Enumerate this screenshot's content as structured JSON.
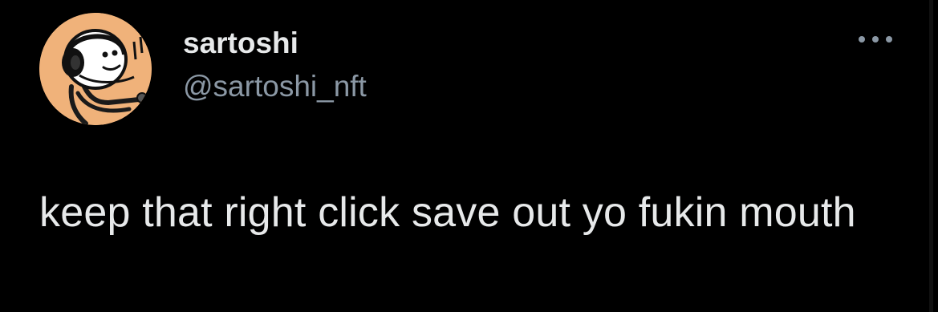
{
  "user": {
    "display_name": "sartoshi",
    "handle": "@sartoshi_nft",
    "avatar_icon": "cartoon-avatar-with-headphones",
    "avatar_bg": "#f0b27a"
  },
  "actions": {
    "more_icon": "ellipsis-icon"
  },
  "tweet": {
    "text": "keep that right click save out yo fukin mouth"
  },
  "colors": {
    "background": "#000000",
    "primary_text": "#e7e9ea",
    "secondary_text": "#8b98a5"
  }
}
